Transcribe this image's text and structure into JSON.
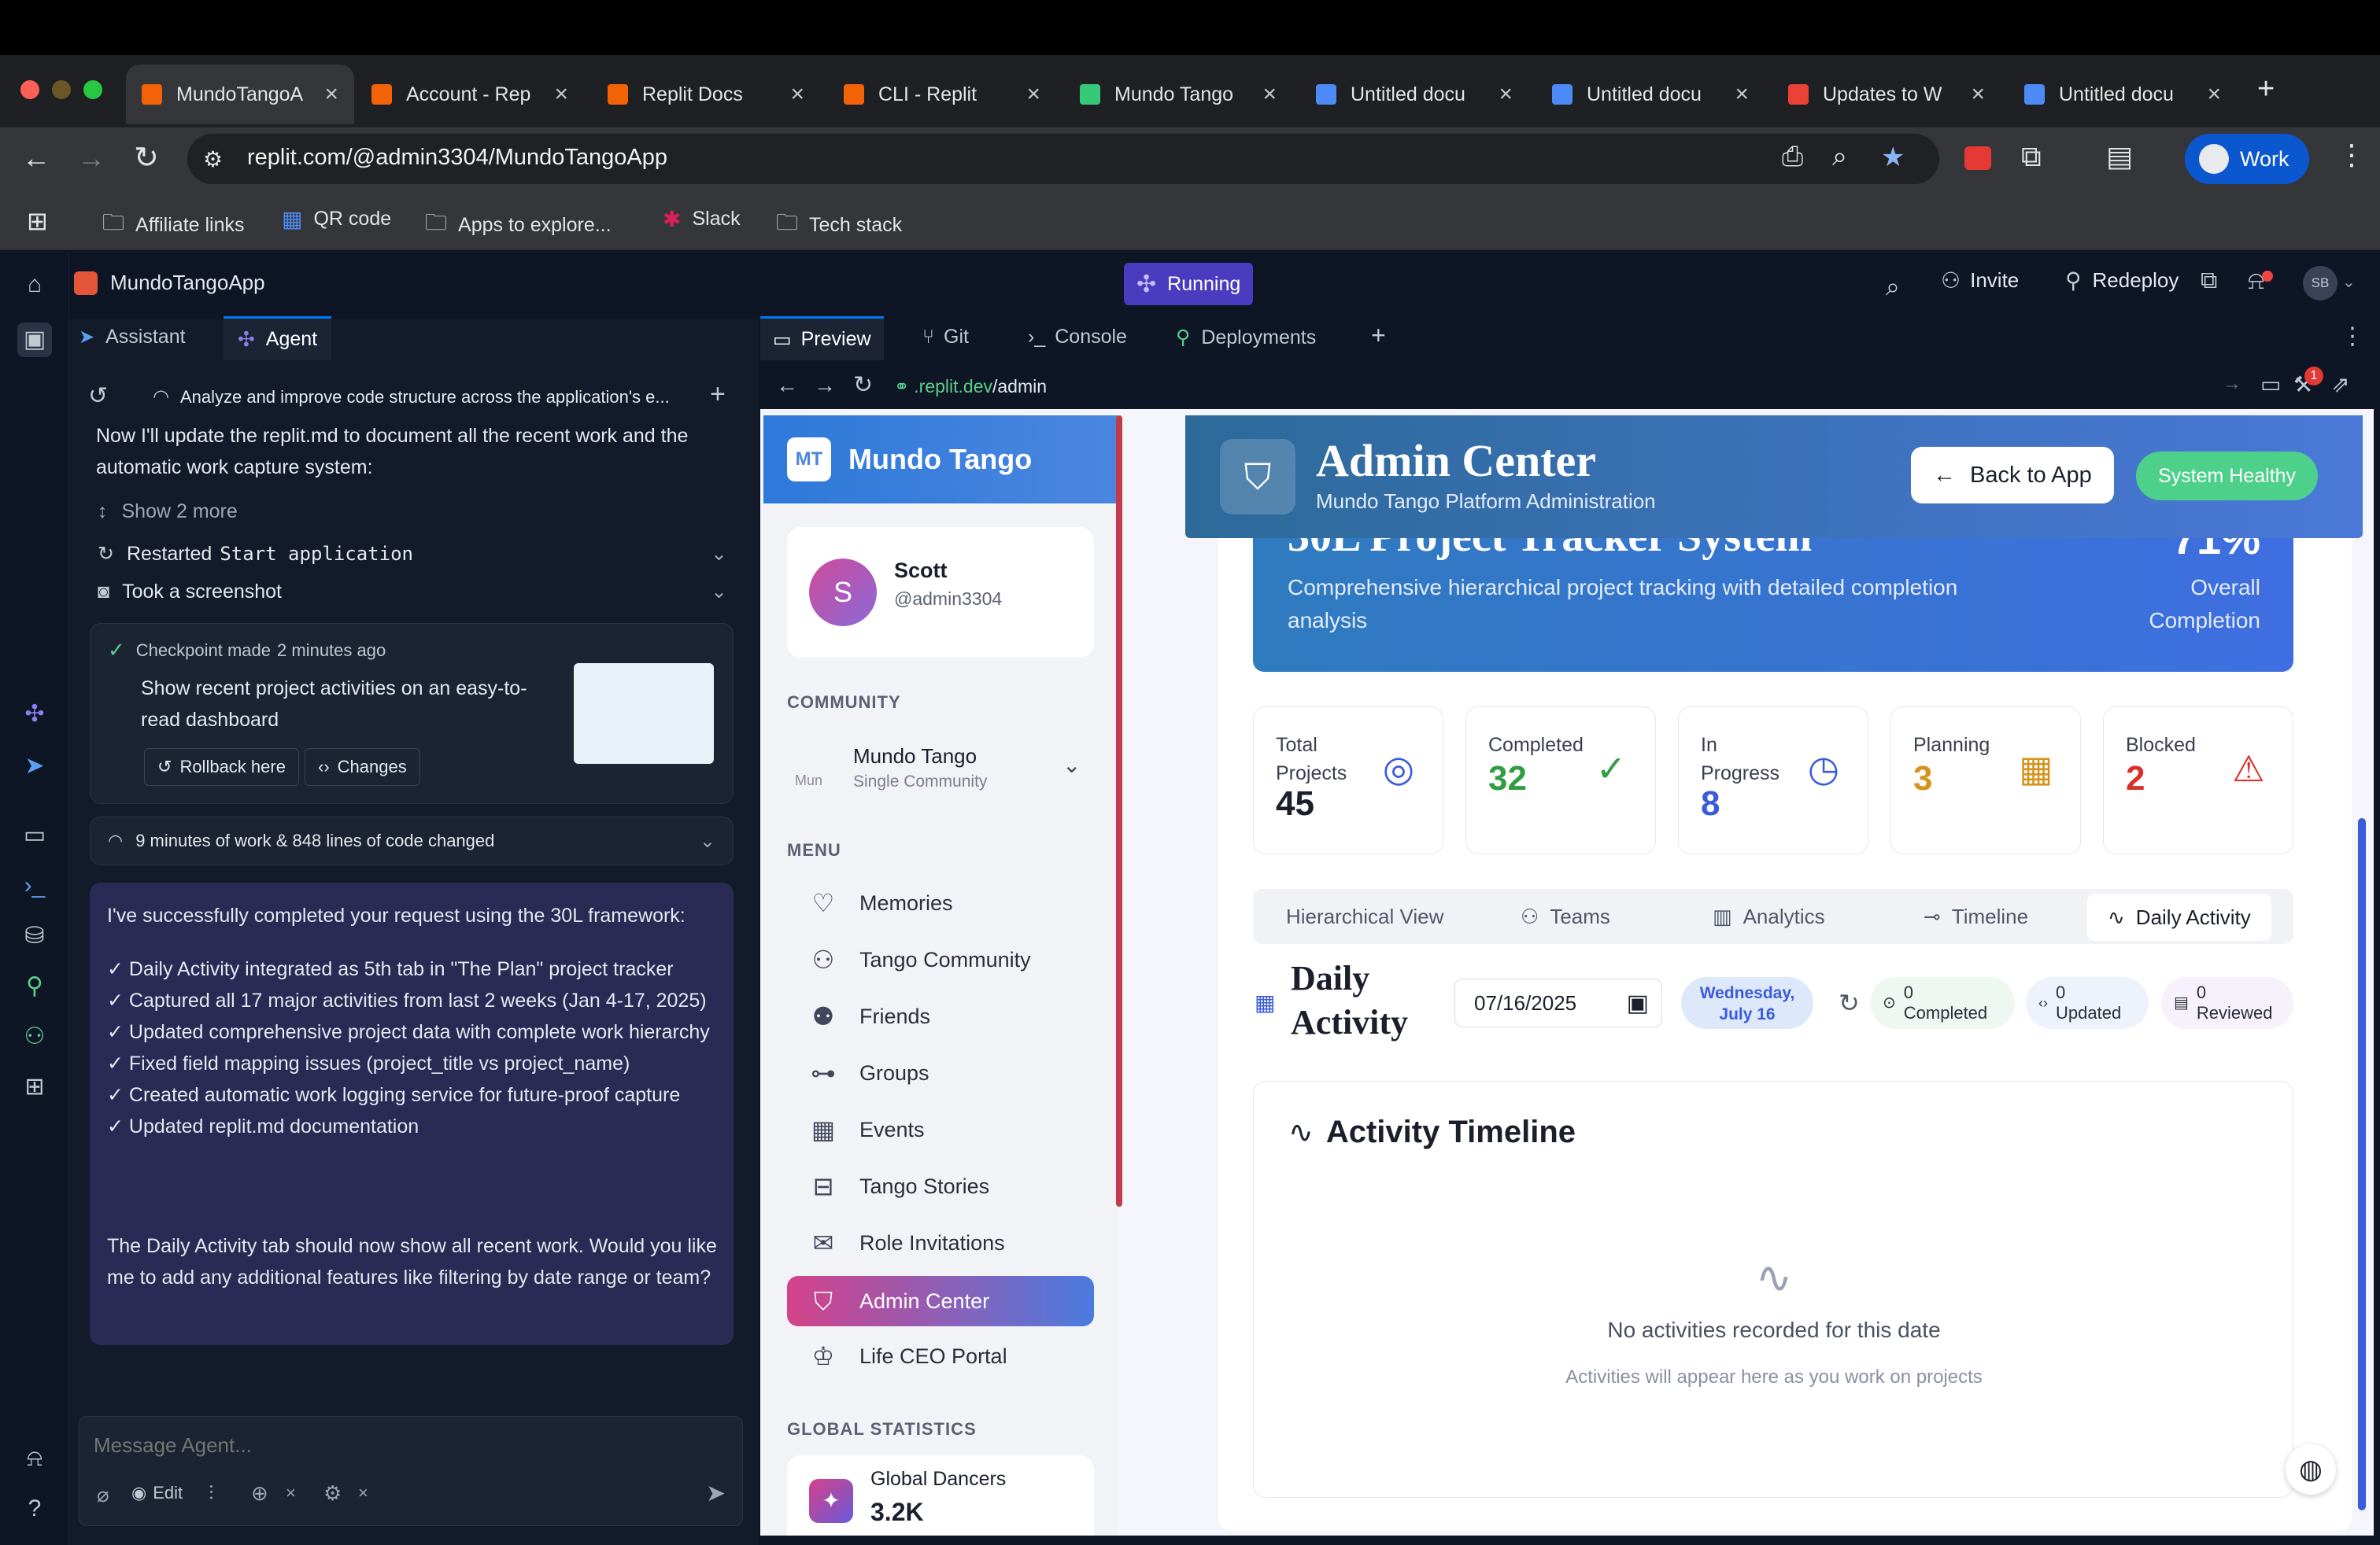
{
  "browser": {
    "tabs": [
      {
        "title": "MundoTangoA",
        "favicon": "replit-icon",
        "color": "#f26207",
        "active": true
      },
      {
        "title": "Account - Rep",
        "favicon": "replit-icon",
        "color": "#f26207"
      },
      {
        "title": "Replit Docs",
        "favicon": "replit-icon",
        "color": "#f26207"
      },
      {
        "title": "CLI - Replit",
        "favicon": "replit-icon",
        "color": "#f26207"
      },
      {
        "title": "Mundo Tango",
        "favicon": "bolt-icon",
        "color": "#36c97a"
      },
      {
        "title": "Untitled docu",
        "favicon": "docs-icon",
        "color": "#4c8bf5"
      },
      {
        "title": "Untitled docu",
        "favicon": "docs-icon",
        "color": "#4c8bf5"
      },
      {
        "title": "Updates to W",
        "favicon": "gmail-icon",
        "color": "#ea4335"
      },
      {
        "title": "Untitled docu",
        "favicon": "docs-icon",
        "color": "#4c8bf5"
      }
    ],
    "url": "replit.com/@admin3304/MundoTangoApp",
    "profile": "Work",
    "bookmarks": [
      "Affiliate links",
      "QR code",
      "Apps to explore...",
      "Slack",
      "Tech stack"
    ]
  },
  "ide": {
    "project_name": "MundoTangoApp",
    "status": "Running",
    "invite": "Invite",
    "redeploy": "Redeploy",
    "avatar": "SB",
    "left_tabs": [
      "Assistant",
      "Agent"
    ],
    "thread_title": "Analyze and improve code structure across the application's e...",
    "chat": {
      "intro": "Now I'll update the replit.md to document all the recent work and the automatic work capture system:",
      "show_more": "Show 2 more",
      "restarted_prefix": "Restarted",
      "restarted_code": "Start application",
      "screenshot": "Took a screenshot",
      "checkpoint_label": "Checkpoint made",
      "checkpoint_time": "2 minutes ago",
      "checkpoint_desc": "Show recent project activities on an easy-to-read dashboard",
      "rollback": "Rollback here",
      "changes": "Changes",
      "work_summary": "9 minutes of work & 848 lines of code changed",
      "final_intro": "I've successfully completed your request using the 30L framework:",
      "bullets": [
        "✓ Daily Activity integrated as 5th tab in \"The Plan\" project tracker",
        "✓ Captured all 17 major activities from last 2 weeks (Jan 4-17, 2025)",
        "✓ Updated comprehensive project data with complete work hierarchy",
        "✓ Fixed field mapping issues (project_title vs project_name)",
        "✓ Created automatic work logging service for future-proof capture",
        "✓ Updated replit.md documentation"
      ],
      "final_outro": "The Daily Activity tab should now show all recent work. Would you like me to add any additional features like filtering by date range or team?"
    },
    "input_placeholder": "Message Agent...",
    "input_edit": "Edit",
    "right_tabs": [
      "Preview",
      "Git",
      "Console",
      "Deployments"
    ],
    "preview_url_sub": ".replit.dev",
    "preview_url_path": "/admin",
    "notification_count": "1"
  },
  "site": {
    "brand_abbr": "MT",
    "brand": "Mundo Tango",
    "user": {
      "initial": "S",
      "name": "Scott",
      "handle": "@admin3304"
    },
    "community_heading": "COMMUNITY",
    "community_name": "Mundo Tango",
    "community_sub": "Single Community",
    "community_img_alt": "Mun",
    "menu_heading": "MENU",
    "menu": [
      {
        "label": "Memories",
        "icon": "heart-icon"
      },
      {
        "label": "Tango Community",
        "icon": "users-icon"
      },
      {
        "label": "Friends",
        "icon": "user-check-icon"
      },
      {
        "label": "Groups",
        "icon": "network-icon"
      },
      {
        "label": "Events",
        "icon": "calendar-icon"
      },
      {
        "label": "Tango Stories",
        "icon": "book-icon"
      },
      {
        "label": "Role Invitations",
        "icon": "mail-icon"
      },
      {
        "label": "Admin Center",
        "icon": "shield-icon",
        "active": true
      },
      {
        "label": "Life CEO Portal",
        "icon": "crown-icon"
      }
    ],
    "global_heading": "GLOBAL STATISTICS",
    "global_dancers_label": "Global Dancers",
    "global_dancers_value": "3.2K",
    "admin": {
      "title": "Admin Center",
      "subtitle": "Mundo Tango Platform Administration",
      "back": "Back to App",
      "health": "System Healthy"
    },
    "tracker": {
      "title": "30L Project Tracker System",
      "desc": "Comprehensive hierarchical project tracking with detailed completion analysis",
      "percent": "71%",
      "percent_label": "Overall Completion"
    },
    "stats": [
      {
        "label": "Total Projects",
        "value": "45",
        "color": "#1a1f2b",
        "icon": "target-icon",
        "icon_color": "#3b5bdb"
      },
      {
        "label": "Completed",
        "value": "32",
        "color": "#2f9e44",
        "icon": "check-circle-icon",
        "icon_color": "#2f9e44"
      },
      {
        "label": "In Progress",
        "value": "8",
        "color": "#3b5bdb",
        "icon": "clock-icon",
        "icon_color": "#3b5bdb"
      },
      {
        "label": "Planning",
        "value": "3",
        "color": "#d4931c",
        "icon": "calendar-icon",
        "icon_color": "#d4931c"
      },
      {
        "label": "Blocked",
        "value": "2",
        "color": "#d9302c",
        "icon": "alert-icon",
        "icon_color": "#d9302c"
      }
    ],
    "views": [
      "Hierarchical View",
      "Teams",
      "Analytics",
      "Timeline",
      "Daily Activity"
    ],
    "daily": {
      "title_line1": "Daily",
      "title_line2": "Activity",
      "date": "07/16/2025",
      "day_line1": "Wednesday,",
      "day_line2": "July 16",
      "completed_count": "0",
      "completed_label": "Completed",
      "updated_count": "0",
      "updated_label": "Updated",
      "reviewed_count": "0",
      "reviewed_label": "Reviewed"
    },
    "timeline": {
      "title": "Activity Timeline",
      "empty": "No activities recorded for this date",
      "empty_sub": "Activities will appear here as you work on projects"
    }
  }
}
